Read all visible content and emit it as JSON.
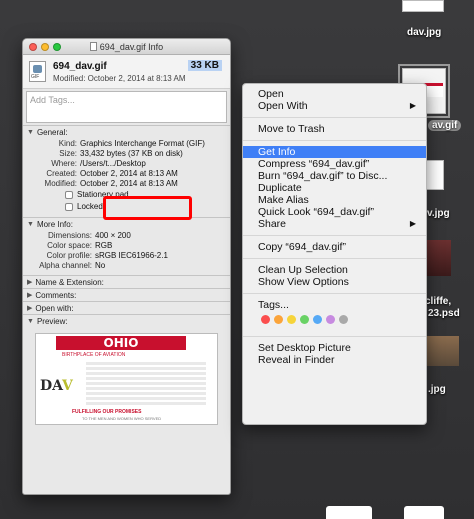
{
  "window": {
    "title": "694_dav.gif Info",
    "file_name": "694_dav.gif",
    "file_size": "33 KB",
    "modified": "Modified: October 2, 2014 at 8:13 AM",
    "tags_placeholder": "Add Tags..."
  },
  "general": {
    "header": "General:",
    "rows": [
      {
        "label": "Kind:",
        "value": "Graphics Interchange Format (GIF)"
      },
      {
        "label": "Size:",
        "value": "33,432 bytes (37 KB on disk)"
      },
      {
        "label": "Where:",
        "value": "/Users/t.../Desktop"
      },
      {
        "label": "Created:",
        "value": "October 2, 2014 at 8:13 AM"
      },
      {
        "label": "Modified:",
        "value": "October 2, 2014 at 8:13 AM"
      }
    ],
    "stationery": "Stationery pad",
    "locked": "Locked"
  },
  "more_info": {
    "header": "More Info:",
    "rows": [
      {
        "label": "Dimensions:",
        "value": "400 × 200"
      },
      {
        "label": "Color space:",
        "value": "RGB"
      },
      {
        "label": "Color profile:",
        "value": "sRGB IEC61966-2.1"
      },
      {
        "label": "Alpha channel:",
        "value": "No"
      }
    ]
  },
  "sections": {
    "name_ext": "Name & Extension:",
    "comments": "Comments:",
    "open_with": "Open with:",
    "preview": "Preview:"
  },
  "preview": {
    "banner": "OHIO",
    "sub": "BIRTHPLACE OF AVIATION",
    "logo_a": "DA",
    "logo_b": "V",
    "foot": "FULFILLING OUR PROMISES",
    "foot2": "TO THE MEN AND WOMEN WHO SERVED"
  },
  "context_menu": {
    "open": "Open",
    "open_with": "Open With",
    "move_trash": "Move to Trash",
    "get_info": "Get Info",
    "compress": "Compress “694_dav.gif”",
    "burn": "Burn “694_dav.gif” to Disc...",
    "duplicate": "Duplicate",
    "make_alias": "Make Alias",
    "quick_look": "Quick Look “694_dav.gif”",
    "share": "Share",
    "copy": "Copy “694_dav.gif”",
    "clean_up": "Clean Up Selection",
    "view_options": "Show View Options",
    "tags": "Tags...",
    "tag_colors": [
      "#fb4e4e",
      "#fba43a",
      "#f6d43a",
      "#69d265",
      "#56a9f5",
      "#c78be0",
      "#a9a9a9"
    ],
    "desktop_picture": "Set Desktop Picture",
    "reveal": "Reveal in Finder"
  },
  "desktop": {
    "dav_jpg": "dav.jpg",
    "gif_partial": "av.gif",
    "jpg_partial": "v.jpg",
    "cliffe_1": "cliffe,",
    "cliffe_2": "23.psd",
    "jpg2_partial": ".jpg"
  }
}
